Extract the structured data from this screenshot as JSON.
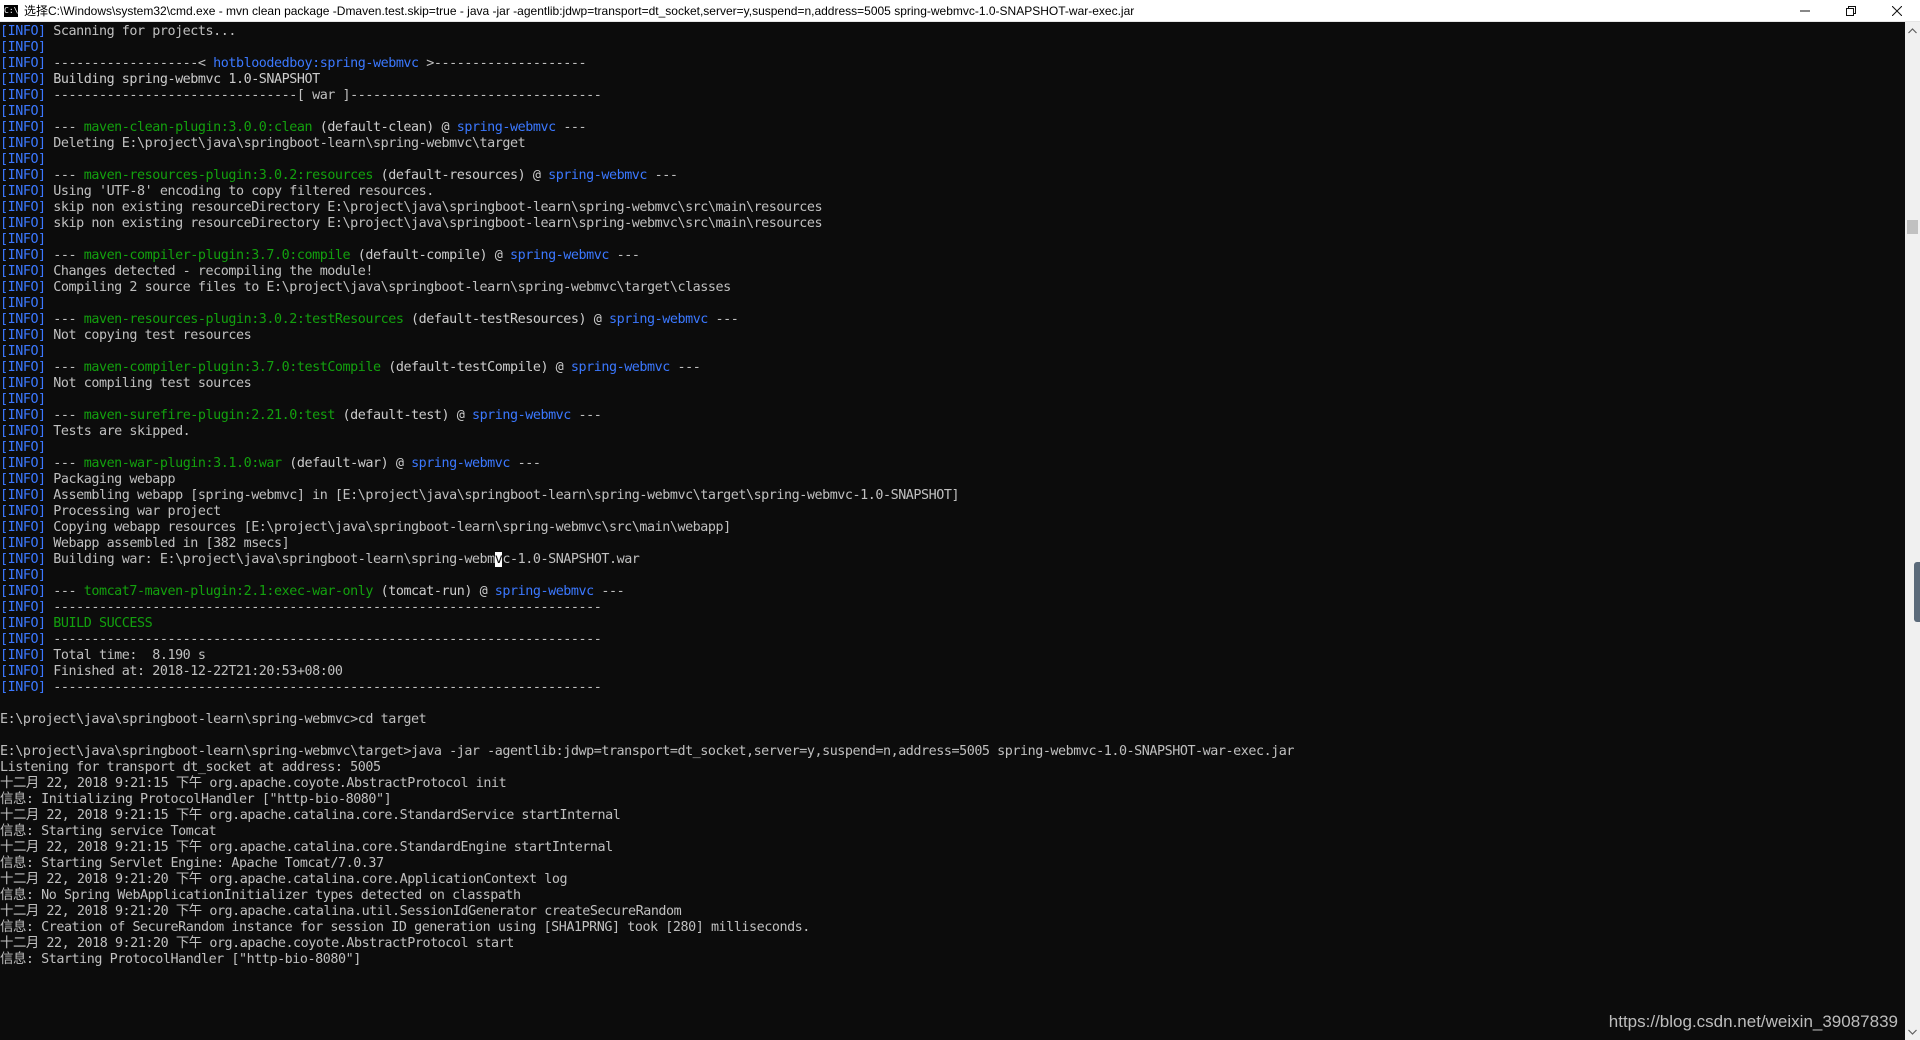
{
  "window": {
    "title": "选择C:\\Windows\\system32\\cmd.exe - mvn  clean package -Dmaven.test.skip=true - java  -jar -agentlib:jdwp=transport=dt_socket,server=y,suspend=n,address=5005 spring-webmvc-1.0-SNAPSHOT-war-exec.jar",
    "icon": "C:\\",
    "minimize": "minimize",
    "maximize": "restore",
    "close": "close"
  },
  "console_lines": [
    [
      {
        "t": "[INFO]",
        "c": "tag-b"
      },
      {
        "t": " Scanning for projects...",
        "c": ""
      }
    ],
    [
      {
        "t": "[INFO]",
        "c": "tag-b"
      }
    ],
    [
      {
        "t": "[INFO]",
        "c": "tag-b"
      },
      {
        "t": " -------------------< ",
        "c": ""
      },
      {
        "t": "hotbloodedboy:spring-webmvc",
        "c": "blue"
      },
      {
        "t": " >--------------------",
        "c": ""
      }
    ],
    [
      {
        "t": "[INFO]",
        "c": "tag-b"
      },
      {
        "t": " Building spring-webmvc 1.0-SNAPSHOT",
        "c": "white"
      }
    ],
    [
      {
        "t": "[INFO]",
        "c": "tag-b"
      },
      {
        "t": " --------------------------------[ war ]---------------------------------",
        "c": ""
      }
    ],
    [
      {
        "t": "[INFO]",
        "c": "tag-b"
      }
    ],
    [
      {
        "t": "[INFO]",
        "c": "tag-b"
      },
      {
        "t": " --- ",
        "c": ""
      },
      {
        "t": "maven-clean-plugin:3.0.0:clean",
        "c": "green"
      },
      {
        "t": " (default-clean) @ ",
        "c": "white"
      },
      {
        "t": "spring-webmvc",
        "c": "blue"
      },
      {
        "t": " ---",
        "c": ""
      }
    ],
    [
      {
        "t": "[INFO]",
        "c": "tag-b"
      },
      {
        "t": " Deleting E:\\project\\java\\springboot-learn\\spring-webmvc\\target",
        "c": ""
      }
    ],
    [
      {
        "t": "[INFO]",
        "c": "tag-b"
      }
    ],
    [
      {
        "t": "[INFO]",
        "c": "tag-b"
      },
      {
        "t": " --- ",
        "c": ""
      },
      {
        "t": "maven-resources-plugin:3.0.2:resources",
        "c": "green"
      },
      {
        "t": " (default-resources) @ ",
        "c": "white"
      },
      {
        "t": "spring-webmvc",
        "c": "blue"
      },
      {
        "t": " ---",
        "c": ""
      }
    ],
    [
      {
        "t": "[INFO]",
        "c": "tag-b"
      },
      {
        "t": " Using 'UTF-8' encoding to copy filtered resources.",
        "c": ""
      }
    ],
    [
      {
        "t": "[INFO]",
        "c": "tag-b"
      },
      {
        "t": " skip non existing resourceDirectory E:\\project\\java\\springboot-learn\\spring-webmvc\\src\\main\\resources",
        "c": ""
      }
    ],
    [
      {
        "t": "[INFO]",
        "c": "tag-b"
      },
      {
        "t": " skip non existing resourceDirectory E:\\project\\java\\springboot-learn\\spring-webmvc\\src\\main\\resources",
        "c": ""
      }
    ],
    [
      {
        "t": "[INFO]",
        "c": "tag-b"
      }
    ],
    [
      {
        "t": "[INFO]",
        "c": "tag-b"
      },
      {
        "t": " --- ",
        "c": ""
      },
      {
        "t": "maven-compiler-plugin:3.7.0:compile",
        "c": "green"
      },
      {
        "t": " (default-compile) @ ",
        "c": "white"
      },
      {
        "t": "spring-webmvc",
        "c": "blue"
      },
      {
        "t": " ---",
        "c": ""
      }
    ],
    [
      {
        "t": "[INFO]",
        "c": "tag-b"
      },
      {
        "t": " Changes detected - recompiling the module!",
        "c": ""
      }
    ],
    [
      {
        "t": "[INFO]",
        "c": "tag-b"
      },
      {
        "t": " Compiling 2 source files to E:\\project\\java\\springboot-learn\\spring-webmvc\\target\\classes",
        "c": ""
      }
    ],
    [
      {
        "t": "[INFO]",
        "c": "tag-b"
      }
    ],
    [
      {
        "t": "[INFO]",
        "c": "tag-b"
      },
      {
        "t": " --- ",
        "c": ""
      },
      {
        "t": "maven-resources-plugin:3.0.2:testResources",
        "c": "green"
      },
      {
        "t": " (default-testResources) @ ",
        "c": "white"
      },
      {
        "t": "spring-webmvc",
        "c": "blue"
      },
      {
        "t": " ---",
        "c": ""
      }
    ],
    [
      {
        "t": "[INFO]",
        "c": "tag-b"
      },
      {
        "t": " Not copying test resources",
        "c": ""
      }
    ],
    [
      {
        "t": "[INFO]",
        "c": "tag-b"
      }
    ],
    [
      {
        "t": "[INFO]",
        "c": "tag-b"
      },
      {
        "t": " --- ",
        "c": ""
      },
      {
        "t": "maven-compiler-plugin:3.7.0:testCompile",
        "c": "green"
      },
      {
        "t": " (default-testCompile) @ ",
        "c": "white"
      },
      {
        "t": "spring-webmvc",
        "c": "blue"
      },
      {
        "t": " ---",
        "c": ""
      }
    ],
    [
      {
        "t": "[INFO]",
        "c": "tag-b"
      },
      {
        "t": " Not compiling test sources",
        "c": ""
      }
    ],
    [
      {
        "t": "[INFO]",
        "c": "tag-b"
      }
    ],
    [
      {
        "t": "[INFO]",
        "c": "tag-b"
      },
      {
        "t": " --- ",
        "c": ""
      },
      {
        "t": "maven-surefire-plugin:2.21.0:test",
        "c": "green"
      },
      {
        "t": " (default-test) @ ",
        "c": "white"
      },
      {
        "t": "spring-webmvc",
        "c": "blue"
      },
      {
        "t": " ---",
        "c": ""
      }
    ],
    [
      {
        "t": "[INFO]",
        "c": "tag-b"
      },
      {
        "t": " Tests are skipped.",
        "c": ""
      }
    ],
    [
      {
        "t": "[INFO]",
        "c": "tag-b"
      }
    ],
    [
      {
        "t": "[INFO]",
        "c": "tag-b"
      },
      {
        "t": " --- ",
        "c": ""
      },
      {
        "t": "maven-war-plugin:3.1.0:war",
        "c": "green"
      },
      {
        "t": " (default-war) @ ",
        "c": "white"
      },
      {
        "t": "spring-webmvc",
        "c": "blue"
      },
      {
        "t": " ---",
        "c": ""
      }
    ],
    [
      {
        "t": "[INFO]",
        "c": "tag-b"
      },
      {
        "t": " Packaging webapp",
        "c": ""
      }
    ],
    [
      {
        "t": "[INFO]",
        "c": "tag-b"
      },
      {
        "t": " Assembling webapp [spring-webmvc] in [E:\\project\\java\\springboot-learn\\spring-webmvc\\target\\spring-webmvc-1.0-SNAPSHOT]",
        "c": ""
      }
    ],
    [
      {
        "t": "[INFO]",
        "c": "tag-b"
      },
      {
        "t": " Processing war project",
        "c": ""
      }
    ],
    [
      {
        "t": "[INFO]",
        "c": "tag-b"
      },
      {
        "t": " Copying webapp resources [E:\\project\\java\\springboot-learn\\spring-webmvc\\src\\main\\webapp]",
        "c": ""
      }
    ],
    [
      {
        "t": "[INFO]",
        "c": "tag-b"
      },
      {
        "t": " Webapp assembled in [382 msecs]",
        "c": ""
      }
    ],
    [
      {
        "t": "[INFO]",
        "c": "tag-b"
      },
      {
        "t": " Building war: E:\\project\\java\\springboot-learn\\spring-webm",
        "c": ""
      },
      {
        "t": "v",
        "c": "cursor-char"
      },
      {
        "t": "c-1.0-SNAPSHOT.war",
        "c": ""
      }
    ],
    [
      {
        "t": "[INFO]",
        "c": "tag-b"
      }
    ],
    [
      {
        "t": "[INFO]",
        "c": "tag-b"
      },
      {
        "t": " --- ",
        "c": ""
      },
      {
        "t": "tomcat7-maven-plugin:2.1:exec-war-only",
        "c": "green"
      },
      {
        "t": " (tomcat-run) @ ",
        "c": "white"
      },
      {
        "t": "spring-webmvc",
        "c": "blue"
      },
      {
        "t": " ---",
        "c": ""
      }
    ],
    [
      {
        "t": "[INFO]",
        "c": "tag-b"
      },
      {
        "t": " ------------------------------------------------------------------------",
        "c": ""
      }
    ],
    [
      {
        "t": "[INFO]",
        "c": "tag-b"
      },
      {
        "t": " BUILD SUCCESS",
        "c": "green"
      }
    ],
    [
      {
        "t": "[INFO]",
        "c": "tag-b"
      },
      {
        "t": " ------------------------------------------------------------------------",
        "c": ""
      }
    ],
    [
      {
        "t": "[INFO]",
        "c": "tag-b"
      },
      {
        "t": " Total time:  8.190 s",
        "c": ""
      }
    ],
    [
      {
        "t": "[INFO]",
        "c": "tag-b"
      },
      {
        "t": " Finished at: 2018-12-22T21:20:53+08:00",
        "c": ""
      }
    ],
    [
      {
        "t": "[INFO]",
        "c": "tag-b"
      },
      {
        "t": " ------------------------------------------------------------------------",
        "c": ""
      }
    ],
    [],
    [
      {
        "t": "E:\\project\\java\\springboot-learn\\spring-webmvc>cd target",
        "c": ""
      }
    ],
    [],
    [
      {
        "t": "E:\\project\\java\\springboot-learn\\spring-webmvc\\target>java -jar -agentlib:jdwp=transport=dt_socket,server=y,suspend=n,address=5005 spring-webmvc-1.0-SNAPSHOT-war-exec.jar",
        "c": ""
      }
    ],
    [
      {
        "t": "Listening for transport dt_socket at address: 5005",
        "c": ""
      }
    ],
    [
      {
        "t": "十二月 22, 2018 9:21:15 下午 org.apache.coyote.AbstractProtocol init",
        "c": ""
      }
    ],
    [
      {
        "t": "信息: Initializing ProtocolHandler [\"http-bio-8080\"]",
        "c": ""
      }
    ],
    [
      {
        "t": "十二月 22, 2018 9:21:15 下午 org.apache.catalina.core.StandardService startInternal",
        "c": ""
      }
    ],
    [
      {
        "t": "信息: Starting service Tomcat",
        "c": ""
      }
    ],
    [
      {
        "t": "十二月 22, 2018 9:21:15 下午 org.apache.catalina.core.StandardEngine startInternal",
        "c": ""
      }
    ],
    [
      {
        "t": "信息: Starting Servlet Engine: Apache Tomcat/7.0.37",
        "c": ""
      }
    ],
    [
      {
        "t": "十二月 22, 2018 9:21:20 下午 org.apache.catalina.core.ApplicationContext log",
        "c": ""
      }
    ],
    [
      {
        "t": "信息: No Spring WebApplicationInitializer types detected on classpath",
        "c": ""
      }
    ],
    [
      {
        "t": "十二月 22, 2018 9:21:20 下午 org.apache.catalina.util.SessionIdGenerator createSecureRandom",
        "c": ""
      }
    ],
    [
      {
        "t": "信息: Creation of SecureRandom instance for session ID generation using [SHA1PRNG] took [280] milliseconds.",
        "c": ""
      }
    ],
    [
      {
        "t": "十二月 22, 2018 9:21:20 下午 org.apache.coyote.AbstractProtocol start",
        "c": ""
      }
    ],
    [
      {
        "t": "信息: Starting ProtocolHandler [\"http-bio-8080\"]",
        "c": ""
      }
    ]
  ],
  "watermark": "https://blog.csdn.net/weixin_39087839"
}
